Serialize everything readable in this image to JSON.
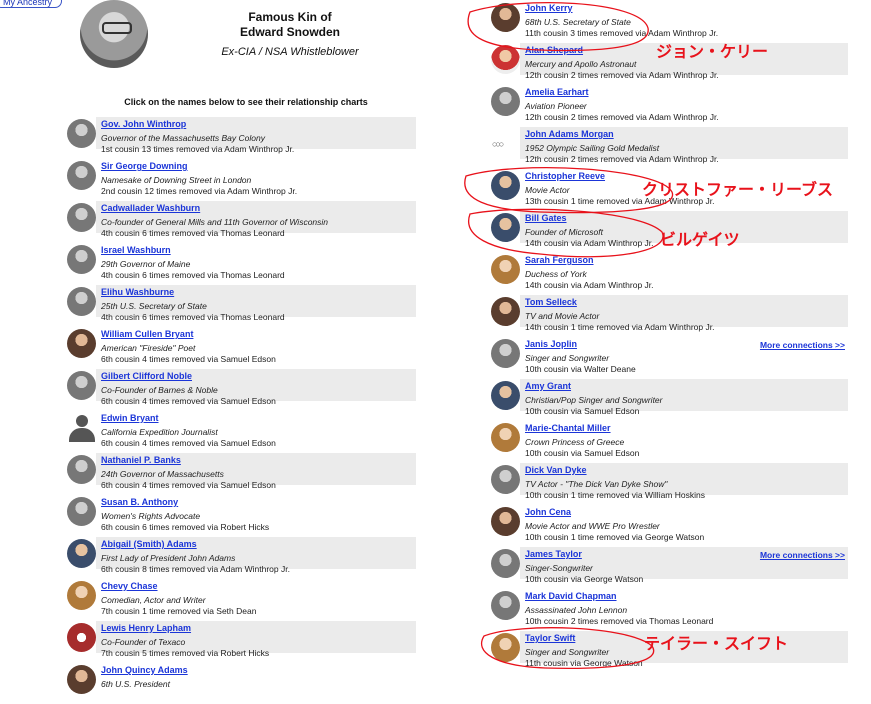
{
  "ancestry_button": "My Ancestry",
  "header": {
    "title_line1": "Famous Kin of",
    "title_line2": "Edward Snowden",
    "subtitle": "Ex-CIA / NSA Whistleblower",
    "instruction": "Click on the names below to see their relationship charts"
  },
  "left_kin": [
    {
      "name": "Gov. John Winthrop",
      "desc": "Governor of the Massachusetts Bay Colony",
      "rel": "1st cousin 13 times removed via Adam Winthrop Jr."
    },
    {
      "name": "Sir George Downing",
      "desc": "Namesake of Downing Street in London",
      "rel": "2nd cousin 12 times removed via Adam Winthrop Jr."
    },
    {
      "name": "Cadwallader Washburn",
      "desc": "Co-founder of General Mills and 11th Governor of Wisconsin",
      "rel": "4th cousin 6 times removed via Thomas Leonard"
    },
    {
      "name": "Israel Washburn",
      "desc": "29th Governor of Maine",
      "rel": "4th cousin 6 times removed via Thomas Leonard"
    },
    {
      "name": "Elihu Washburne",
      "desc": "25th U.S. Secretary of State",
      "rel": "4th cousin 6 times removed via Thomas Leonard"
    },
    {
      "name": "William Cullen Bryant",
      "desc": "American \"Fireside\" Poet",
      "rel": "6th cousin 4 times removed via Samuel Edson"
    },
    {
      "name": "Gilbert Clifford Noble",
      "desc": "Co-Founder of Barnes & Noble",
      "rel": "6th cousin 4 times removed via Samuel Edson"
    },
    {
      "name": "Edwin Bryant",
      "desc": "California Expedition Journalist",
      "rel": "6th cousin 4 times removed via Samuel Edson"
    },
    {
      "name": "Nathaniel P. Banks",
      "desc": "24th Governor of Massachusetts",
      "rel": "6th cousin 4 times removed via Samuel Edson"
    },
    {
      "name": "Susan B. Anthony",
      "desc": "Women's Rights Advocate",
      "rel": "6th cousin 6 times removed via Robert Hicks"
    },
    {
      "name": "Abigail (Smith) Adams",
      "desc": "First Lady of President John Adams",
      "rel": "6th cousin 8 times removed via Adam Winthrop Jr."
    },
    {
      "name": "Chevy Chase",
      "desc": "Comedian, Actor and Writer",
      "rel": "7th cousin 1 time removed via Seth Dean"
    },
    {
      "name": "Lewis Henry Lapham",
      "desc": "Co-Founder of Texaco",
      "rel": "7th cousin 5 times removed via Robert Hicks"
    },
    {
      "name": "John Quincy Adams",
      "desc": "6th U.S. President",
      "rel": ""
    }
  ],
  "right_kin": [
    {
      "name": "John Kerry",
      "desc": "68th U.S. Secretary of State",
      "rel": "11th cousin 3 times removed via Adam Winthrop Jr.",
      "more": ""
    },
    {
      "name": "Alan Shepard",
      "desc": "Mercury and Apollo Astronaut",
      "rel": "12th cousin 2 times removed via Adam Winthrop Jr.",
      "more": ""
    },
    {
      "name": "Amelia Earhart",
      "desc": "Aviation Pioneer",
      "rel": "12th cousin 2 times removed via Adam Winthrop Jr.",
      "more": ""
    },
    {
      "name": "John Adams Morgan",
      "desc": "1952 Olympic Sailing Gold Medalist",
      "rel": "12th cousin 2 times removed via Adam Winthrop Jr.",
      "more": ""
    },
    {
      "name": "Christopher Reeve",
      "desc": "Movie Actor",
      "rel": "13th cousin 1 time removed via Adam Winthrop Jr.",
      "more": ""
    },
    {
      "name": "Bill Gates",
      "desc": "Founder of Microsoft",
      "rel": "14th cousin via Adam Winthrop Jr.",
      "more": ""
    },
    {
      "name": "Sarah Ferguson",
      "desc": "Duchess of York",
      "rel": "14th cousin via Adam Winthrop Jr.",
      "more": ""
    },
    {
      "name": "Tom Selleck",
      "desc": "TV and Movie Actor",
      "rel": "14th cousin 1 time removed via Adam Winthrop Jr.",
      "more": ""
    },
    {
      "name": "Janis Joplin",
      "desc": "Singer and Songwriter",
      "rel": "10th cousin via Walter Deane",
      "more": "More connections >>"
    },
    {
      "name": "Amy Grant",
      "desc": "Christian/Pop Singer and Songwriter",
      "rel": "10th cousin via Samuel Edson",
      "more": ""
    },
    {
      "name": "Marie-Chantal Miller",
      "desc": "Crown Princess of Greece",
      "rel": "10th cousin via Samuel Edson",
      "more": ""
    },
    {
      "name": "Dick Van Dyke",
      "desc": "TV Actor - \"The Dick Van Dyke Show\"",
      "rel": "10th cousin 1 time removed via William Hoskins",
      "more": ""
    },
    {
      "name": "John Cena",
      "desc": "Movie Actor and WWE Pro Wrestler",
      "rel": "10th cousin 1 time removed via George Watson",
      "more": ""
    },
    {
      "name": "James Taylor",
      "desc": "Singer-Songwriter",
      "rel": "10th cousin via George Watson",
      "more": "More connections >>"
    },
    {
      "name": "Mark David Chapman",
      "desc": "Assassinated John Lennon",
      "rel": "10th cousin 2 times removed via Thomas Leonard",
      "more": ""
    },
    {
      "name": "Taylor Swift",
      "desc": "Singer and Songwriter",
      "rel": "11th cousin via George Watson",
      "more": ""
    }
  ],
  "annotations": {
    "kerry": "ジョン・ケリー",
    "reeve": "クリストファー・リーブス",
    "gates": "ビルゲイツ",
    "swift": "テイラー・スイフト"
  },
  "colors": {
    "link": "#1b35d8",
    "row_shade": "#ebebeb",
    "annotation": "#e8121b"
  }
}
